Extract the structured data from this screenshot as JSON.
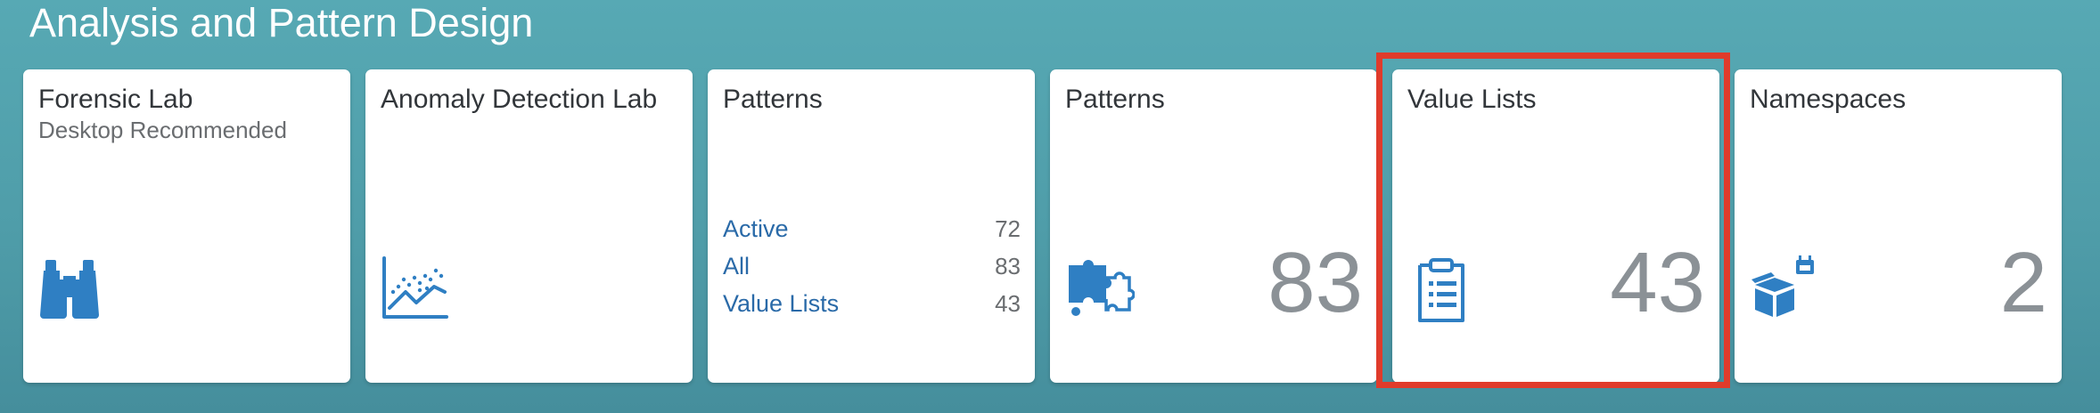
{
  "group": {
    "title": "Analysis and Pattern Design"
  },
  "tiles": [
    {
      "title": "Forensic Lab",
      "subtitle": "Desktop Recommended",
      "icon": "binoculars-icon"
    },
    {
      "title": "Anomaly Detection Lab",
      "icon": "line-chart-icon"
    },
    {
      "title": "Patterns",
      "links": [
        {
          "label": "Active",
          "count": "72"
        },
        {
          "label": "All",
          "count": "83"
        },
        {
          "label": "Value Lists",
          "count": "43"
        }
      ]
    },
    {
      "title": "Patterns",
      "number": "83",
      "icon": "puzzle-icon"
    },
    {
      "title": "Value Lists",
      "number": "43",
      "icon": "clipboard-list-icon",
      "highlighted": true
    },
    {
      "title": "Namespaces",
      "number": "2",
      "icon": "open-box-icon"
    }
  ],
  "colors": {
    "background": "#4f9da9",
    "icon_blue": "#2f7fc3",
    "link_blue": "#2a6aa8",
    "number_gray": "#8b9196",
    "highlight_red": "#e03b2b"
  }
}
